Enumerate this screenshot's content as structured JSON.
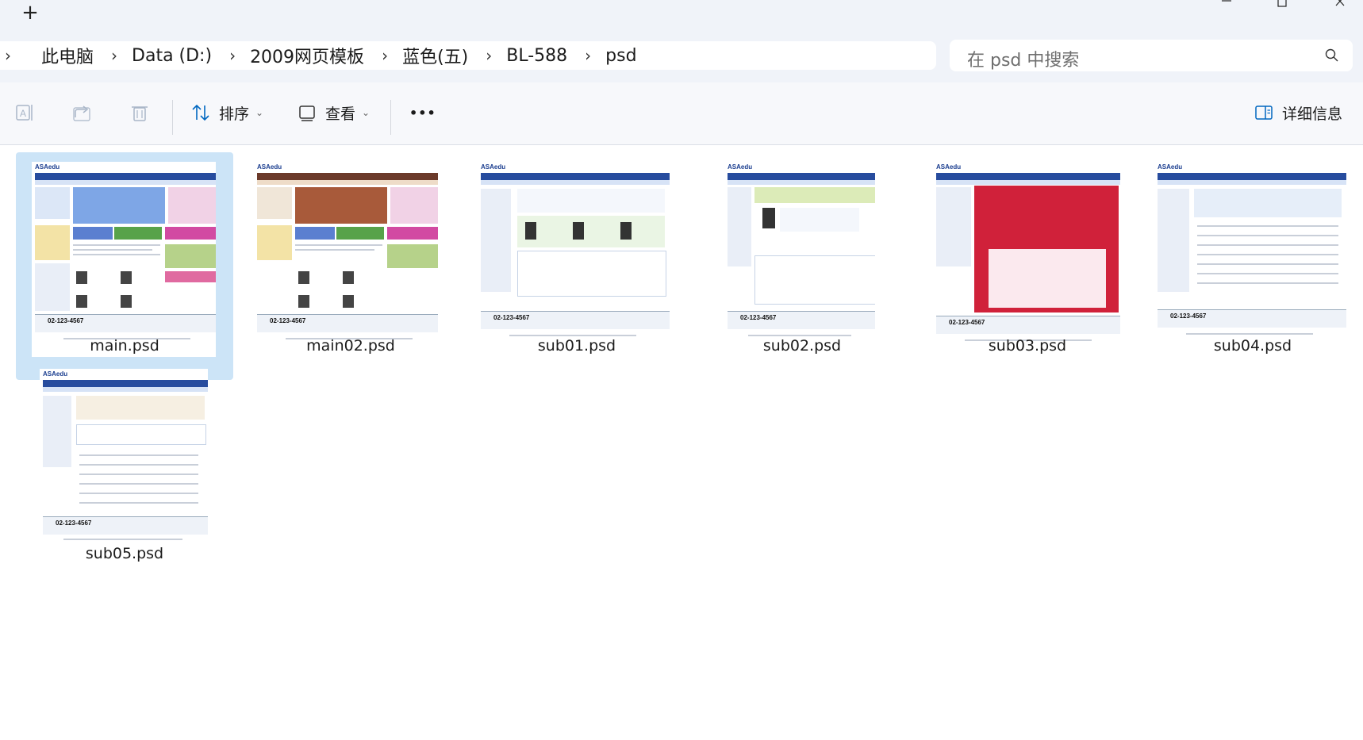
{
  "tabbar": {
    "add_label": "+"
  },
  "breadcrumb": {
    "items": [
      "此电脑",
      "Data (D:)",
      "2009网页模板",
      "蓝色(五)",
      "BL-588",
      "psd"
    ]
  },
  "search": {
    "placeholder": "在 psd 中搜索"
  },
  "toolbar": {
    "sort_label": "排序",
    "view_label": "查看",
    "more_label": "•••",
    "details_label": "详细信息"
  },
  "files": [
    {
      "name": "main.psd",
      "selected": true,
      "phone": "02-123-4567"
    },
    {
      "name": "main02.psd",
      "selected": false,
      "phone": "02-123-4567"
    },
    {
      "name": "sub01.psd",
      "selected": false,
      "phone": "02-123-4567"
    },
    {
      "name": "sub02.psd",
      "selected": false,
      "phone": "02-123-4567"
    },
    {
      "name": "sub03.psd",
      "selected": false,
      "phone": "02-123-4567"
    },
    {
      "name": "sub04.psd",
      "selected": false,
      "phone": "02-123-4567"
    },
    {
      "name": "sub05.psd",
      "selected": false,
      "phone": "02-123-4567"
    }
  ],
  "thumb_text": {
    "logo": "ASAedu"
  },
  "colors": {
    "selection": "#cce4f7",
    "accent": "#0067c0",
    "nav": "#274c9e"
  }
}
